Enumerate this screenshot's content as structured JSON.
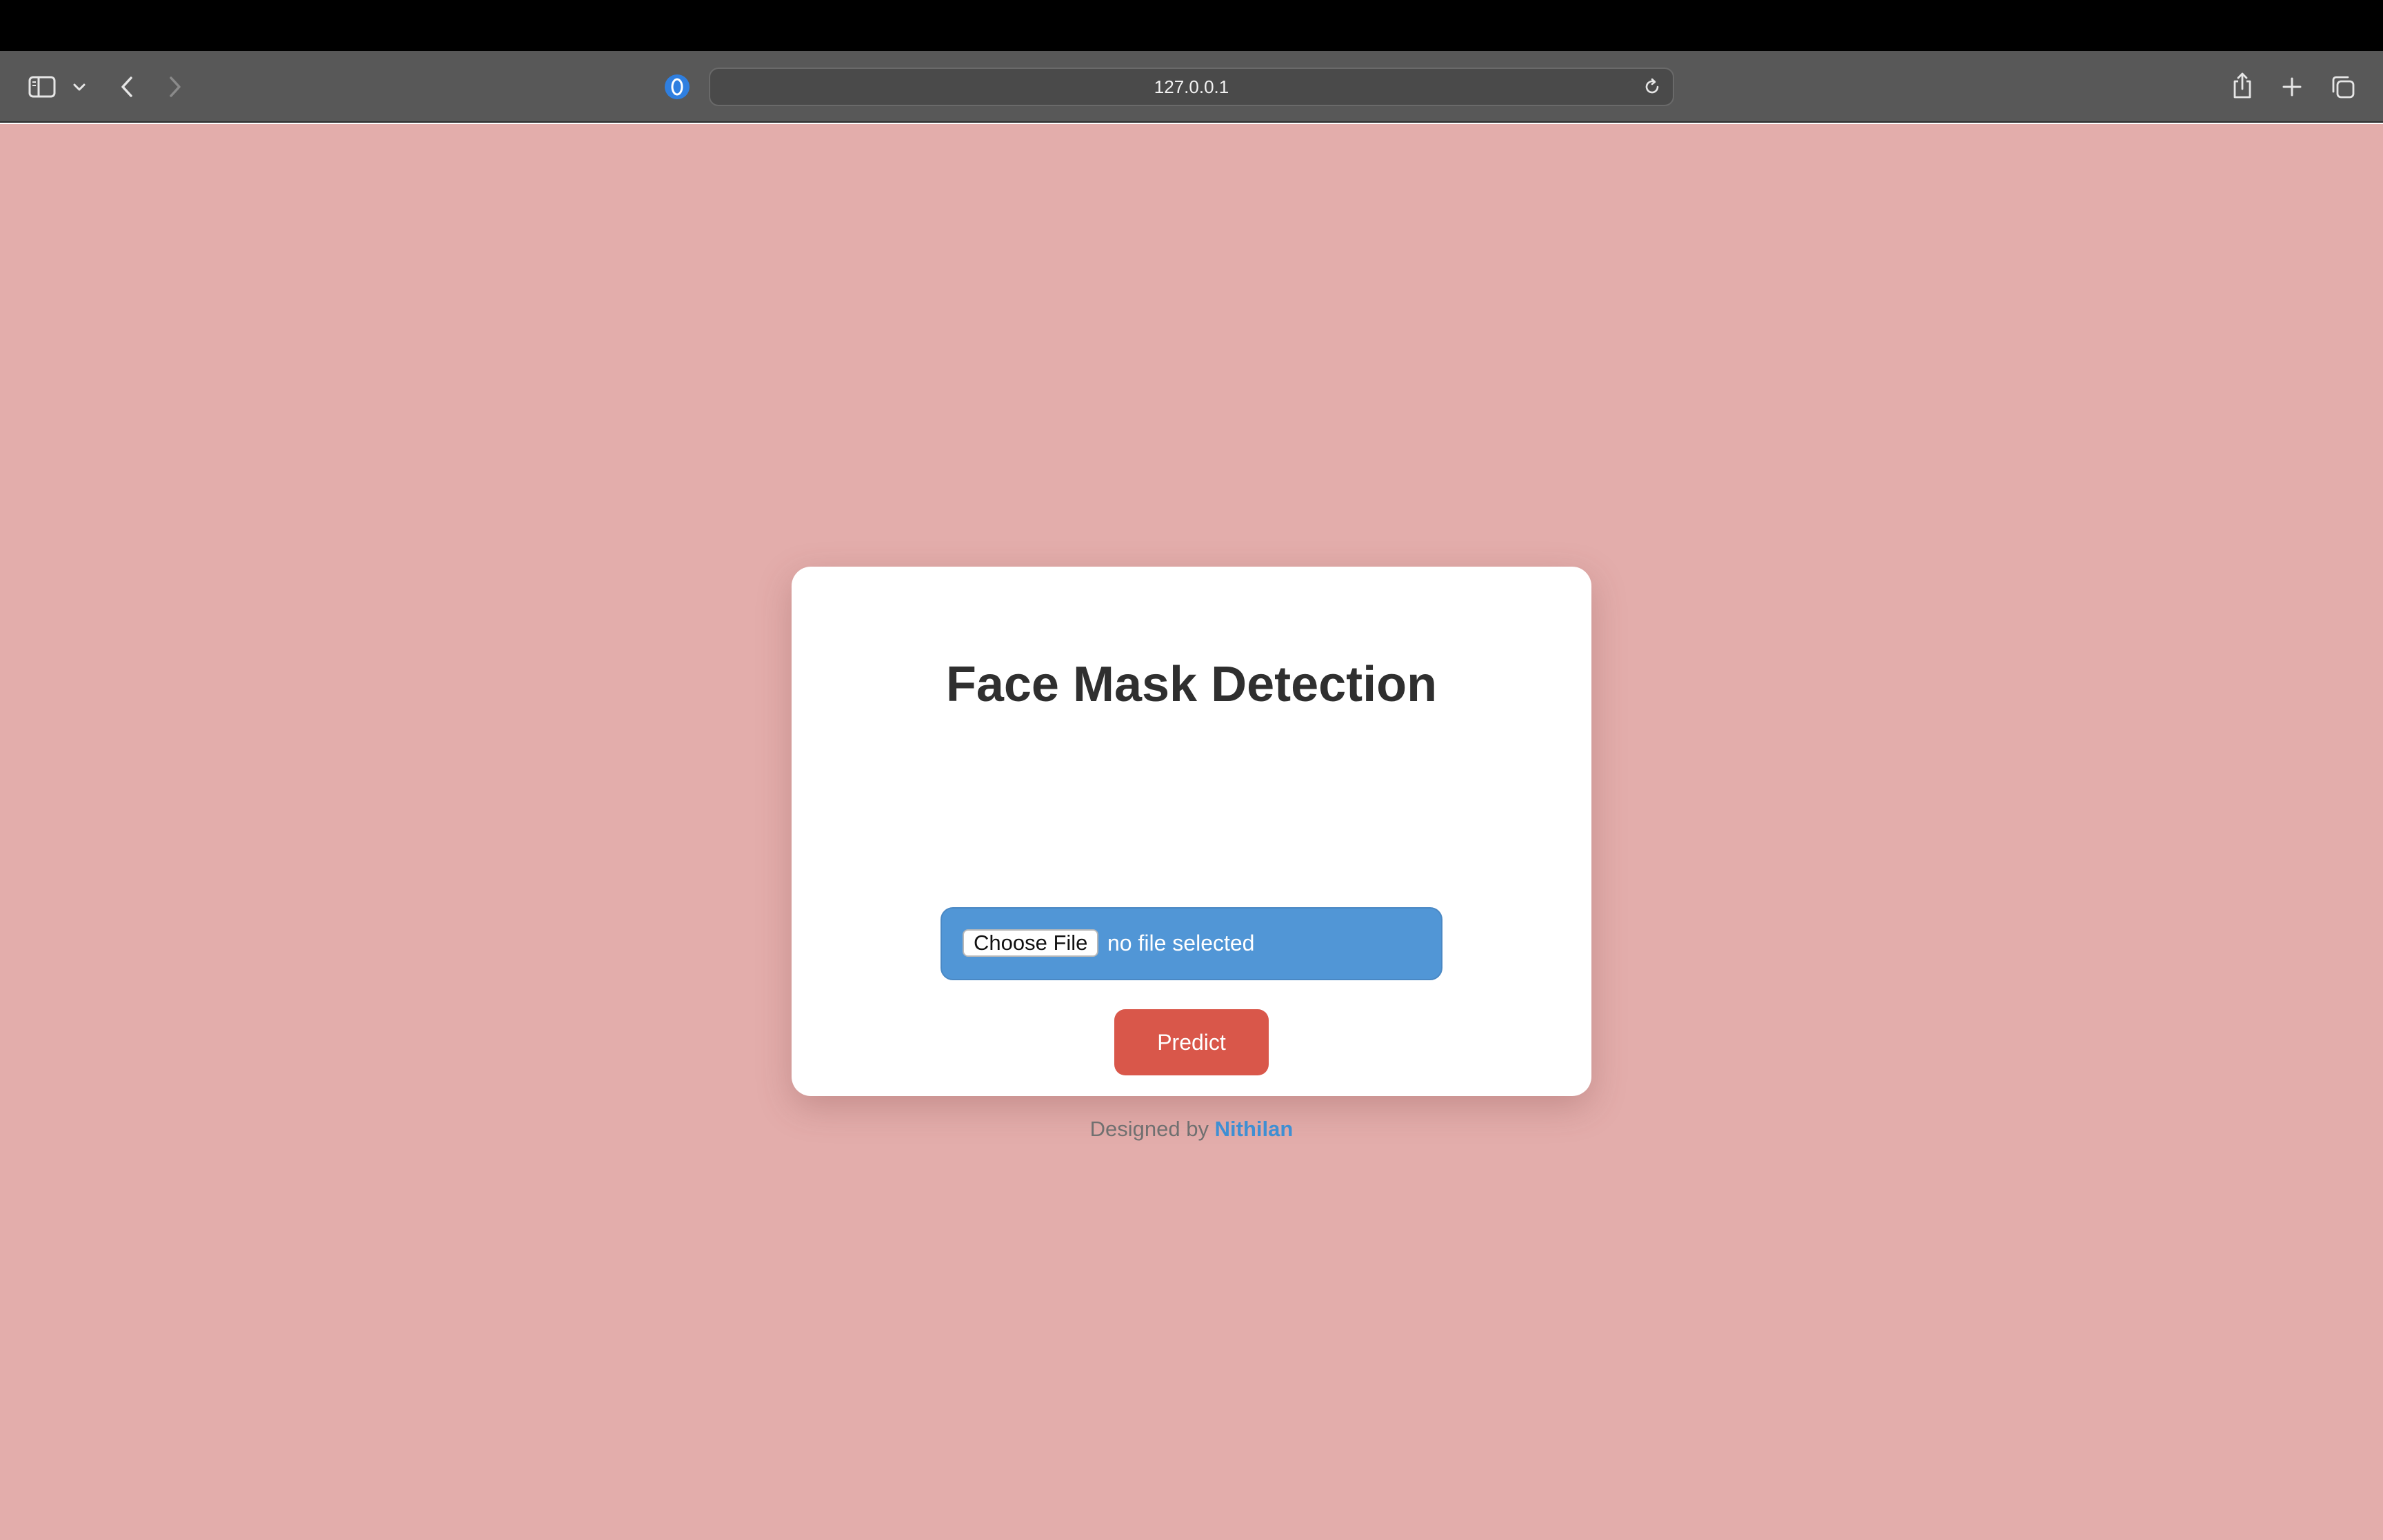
{
  "browser": {
    "address": "127.0.0.1",
    "icons": {
      "sidebar": "sidebar-toggle-icon",
      "chevron": "chevron-down-icon",
      "back": "back-arrow-icon",
      "forward": "forward-arrow-icon",
      "extension": "extension-shield-icon",
      "reload": "reload-icon",
      "share": "share-icon",
      "new_tab": "plus-icon",
      "tabs": "tab-overview-icon"
    }
  },
  "page": {
    "background_color": "#e3adab",
    "title": "Face Mask Detection",
    "file_input": {
      "button_label": "Choose File",
      "status": "no file selected",
      "background_color": "#5196d6"
    },
    "predict_button": {
      "label": "Predict",
      "color": "#d9574a"
    },
    "footer": {
      "prefix": "Designed by",
      "author": "Nithilan",
      "author_color": "#3f8fd3"
    }
  }
}
